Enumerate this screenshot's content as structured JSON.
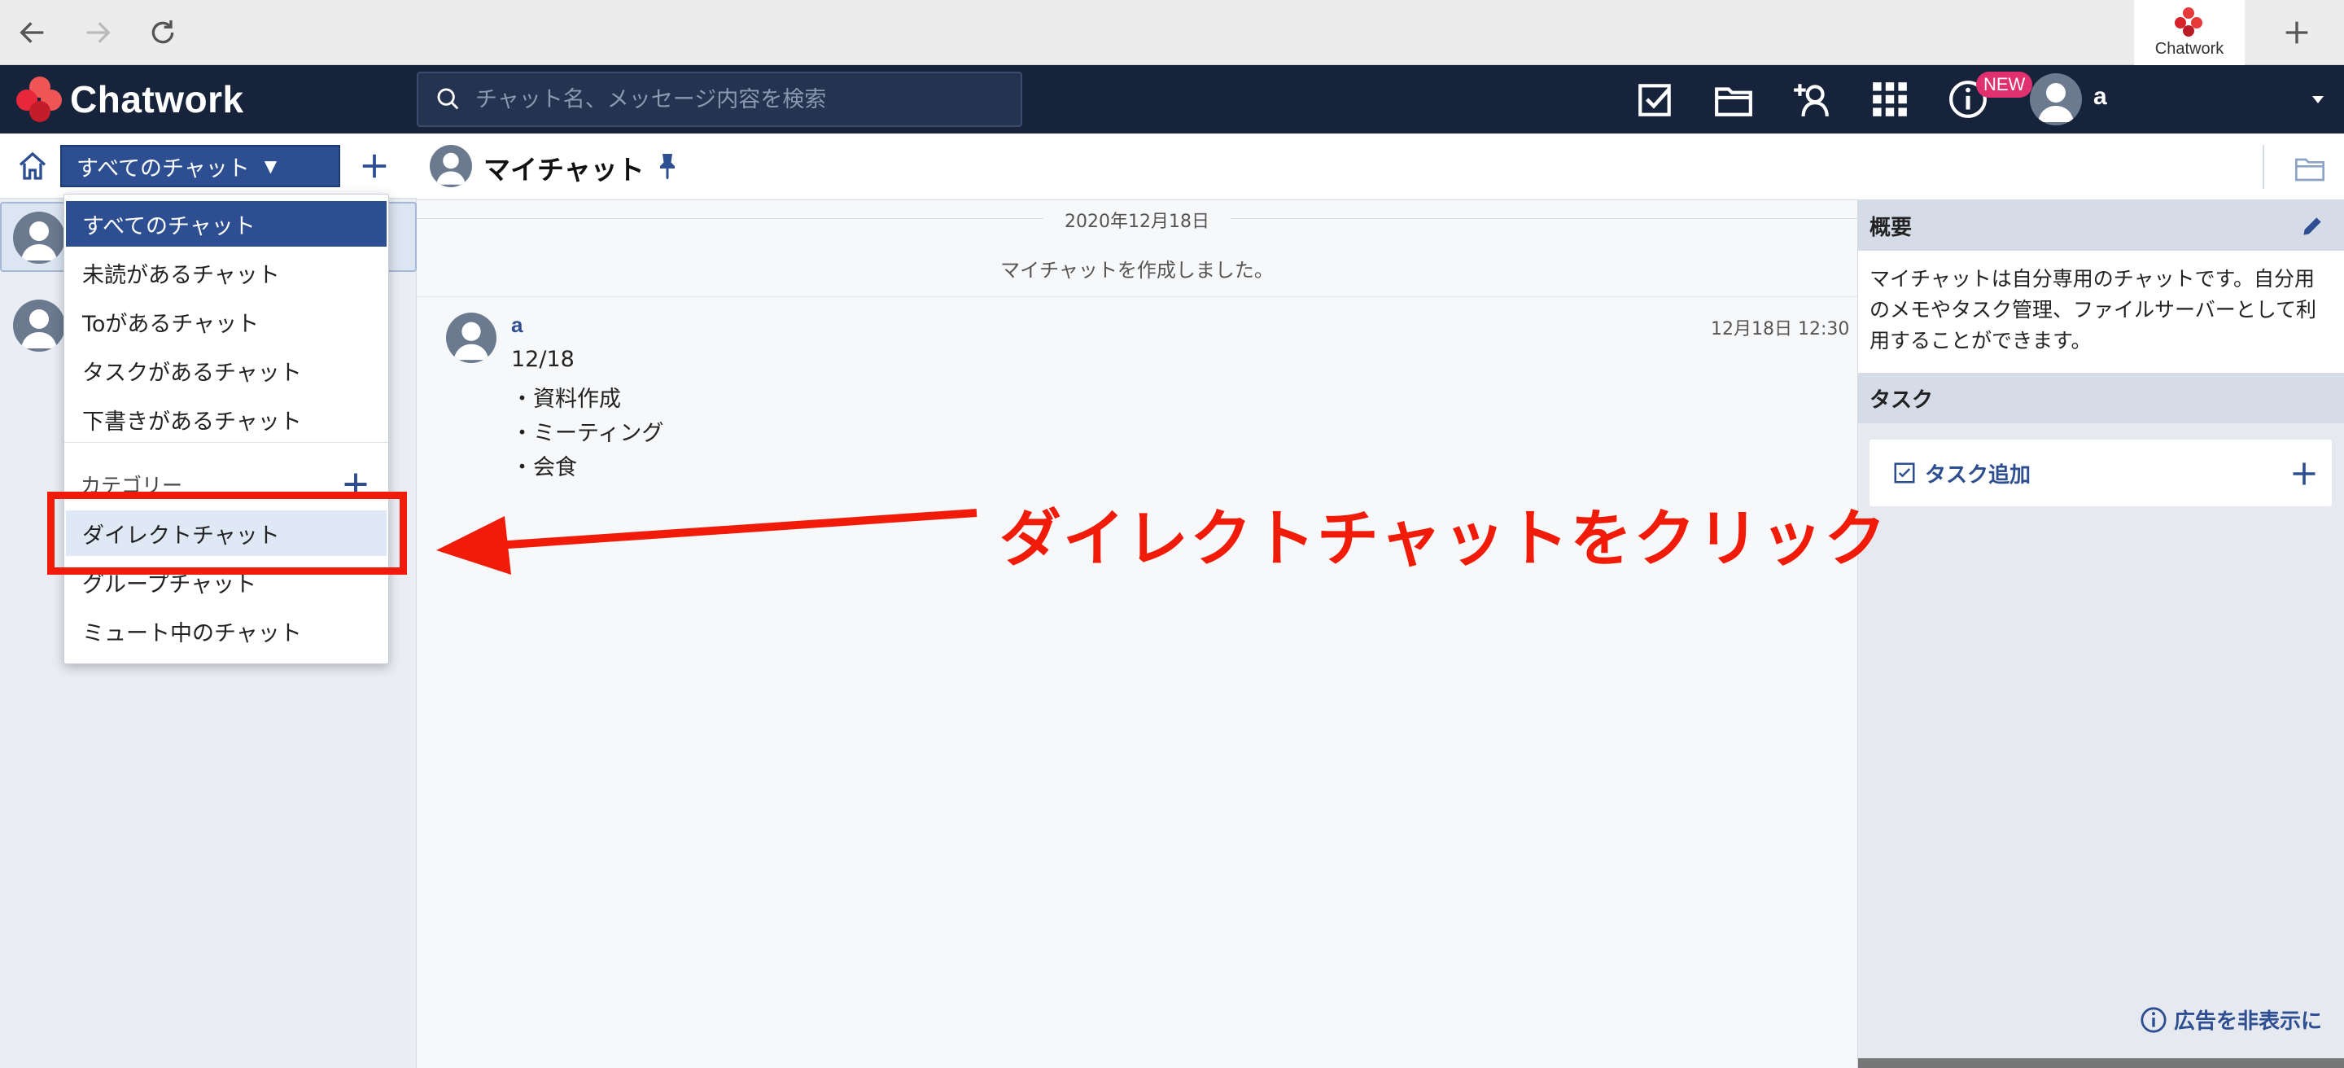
{
  "browser": {
    "tab_label": "Chatwork"
  },
  "header": {
    "logo_text": "Chatwork",
    "search_placeholder": "チャット名、メッセージ内容を検索",
    "new_badge": "NEW",
    "user_name": "a"
  },
  "sidebar": {
    "filter_label": "すべてのチャット",
    "dropdown": {
      "items": [
        "すべてのチャット",
        "未読があるチャット",
        "Toがあるチャット",
        "タスクがあるチャット",
        "下書きがあるチャット"
      ],
      "category_label": "カテゴリー",
      "category_items": [
        "ダイレクトチャット",
        "グループチャット",
        "ミュート中のチャット"
      ]
    }
  },
  "chat": {
    "title": "マイチャット",
    "date": "2020年12月18日",
    "system_message": "マイチャットを作成しました。",
    "message": {
      "sender": "a",
      "time": "12月18日 12:30",
      "lines": [
        "12/18",
        "・資料作成",
        "・ミーティング",
        "・会食"
      ]
    }
  },
  "annotation": {
    "text": "ダイレクトチャットをクリック",
    "color": "#f11b0a"
  },
  "right_panel": {
    "overview_title": "概要",
    "overview_text": "マイチャットは自分専用のチャットです。自分用のメモやタスク管理、ファイルサーバーとして利用することができます。",
    "task_title": "タスク",
    "task_add_label": "タスク追加",
    "hide_ads_label": "広告を非表示に"
  },
  "colors": {
    "header_bg": "#16233a",
    "accent": "#2d4e91",
    "badge": "#e0306e",
    "highlight": "#f11b0a"
  }
}
